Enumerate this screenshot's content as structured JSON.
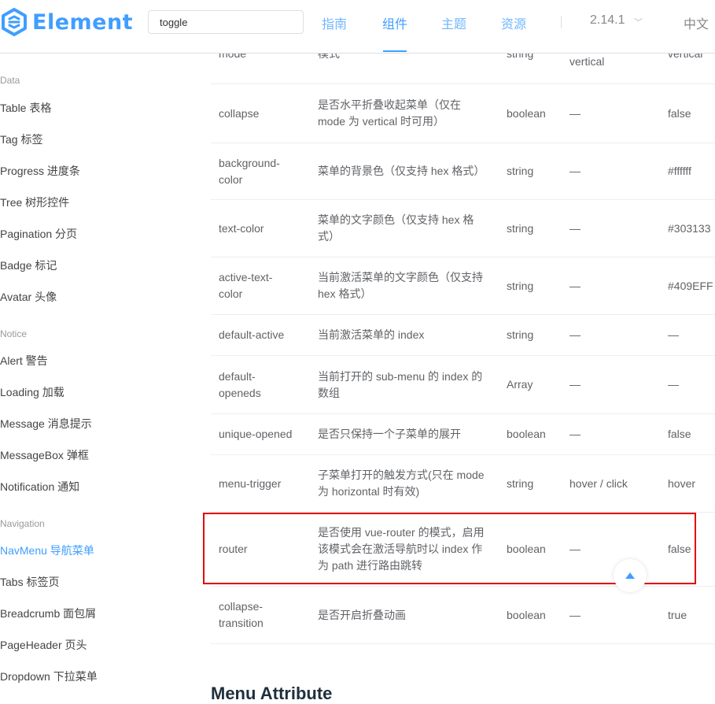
{
  "header": {
    "logo_text": "Element",
    "search_value": "toggle",
    "nav": [
      {
        "label": "指南"
      },
      {
        "label": "组件"
      },
      {
        "label": "主题"
      },
      {
        "label": "资源"
      }
    ],
    "version": "2.14.1",
    "language": "中文"
  },
  "sidebar": {
    "groups": {
      "data": "Data",
      "notice": "Notice",
      "navigation": "Navigation"
    },
    "items": {
      "table": "Table 表格",
      "tag": "Tag 标签",
      "progress": "Progress 进度条",
      "tree": "Tree 树形控件",
      "pagination": "Pagination 分页",
      "badge": "Badge 标记",
      "avatar": "Avatar 头像",
      "alert": "Alert 警告",
      "loading": "Loading 加载",
      "message": "Message 消息提示",
      "messagebox": "MessageBox 弹框",
      "notification": "Notification 通知",
      "navmenu": "NavMenu 导航菜单",
      "tabs": "Tabs 标签页",
      "breadcrumb": "Breadcrumb 面包屑",
      "pageheader": "PageHeader 页头",
      "dropdown": "Dropdown 下拉菜单"
    }
  },
  "table": {
    "rows": [
      {
        "name": "mode",
        "desc": "模式",
        "type": "string",
        "options": "horizontal / vertical",
        "default": "vertical"
      },
      {
        "name": "collapse",
        "desc": "是否水平折叠收起菜单（仅在 mode 为 vertical 时可用）",
        "type": "boolean",
        "options": "—",
        "default": "false"
      },
      {
        "name": "background-color",
        "desc": "菜单的背景色（仅支持 hex 格式）",
        "type": "string",
        "options": "—",
        "default": "#ffffff"
      },
      {
        "name": "text-color",
        "desc": "菜单的文字颜色（仅支持 hex 格式）",
        "type": "string",
        "options": "—",
        "default": "#303133"
      },
      {
        "name": "active-text-color",
        "desc": "当前激活菜单的文字颜色（仅支持 hex 格式）",
        "type": "string",
        "options": "—",
        "default": "#409EFF"
      },
      {
        "name": "default-active",
        "desc": "当前激活菜单的 index",
        "type": "string",
        "options": "—",
        "default": "—"
      },
      {
        "name": "default-openeds",
        "desc": "当前打开的 sub-menu 的 index 的数组",
        "type": "Array",
        "options": "—",
        "default": "—"
      },
      {
        "name": "unique-opened",
        "desc": "是否只保持一个子菜单的展开",
        "type": "boolean",
        "options": "—",
        "default": "false"
      },
      {
        "name": "menu-trigger",
        "desc": "子菜单打开的触发方式(只在 mode 为 horizontal 时有效)",
        "type": "string",
        "options": "hover / click",
        "default": "hover"
      },
      {
        "name": "router",
        "desc": "是否使用 vue-router 的模式，启用该模式会在激活导航时以 index 作为 path 进行路由跳转",
        "type": "boolean",
        "options": "—",
        "default": "false"
      },
      {
        "name": "collapse-transition",
        "desc": "是否开启折叠动画",
        "type": "boolean",
        "options": "—",
        "default": "true"
      }
    ]
  },
  "next_section_title": "Menu Attribute",
  "colors": {
    "brand": "#409eff",
    "highlight_border": "#e10000"
  }
}
